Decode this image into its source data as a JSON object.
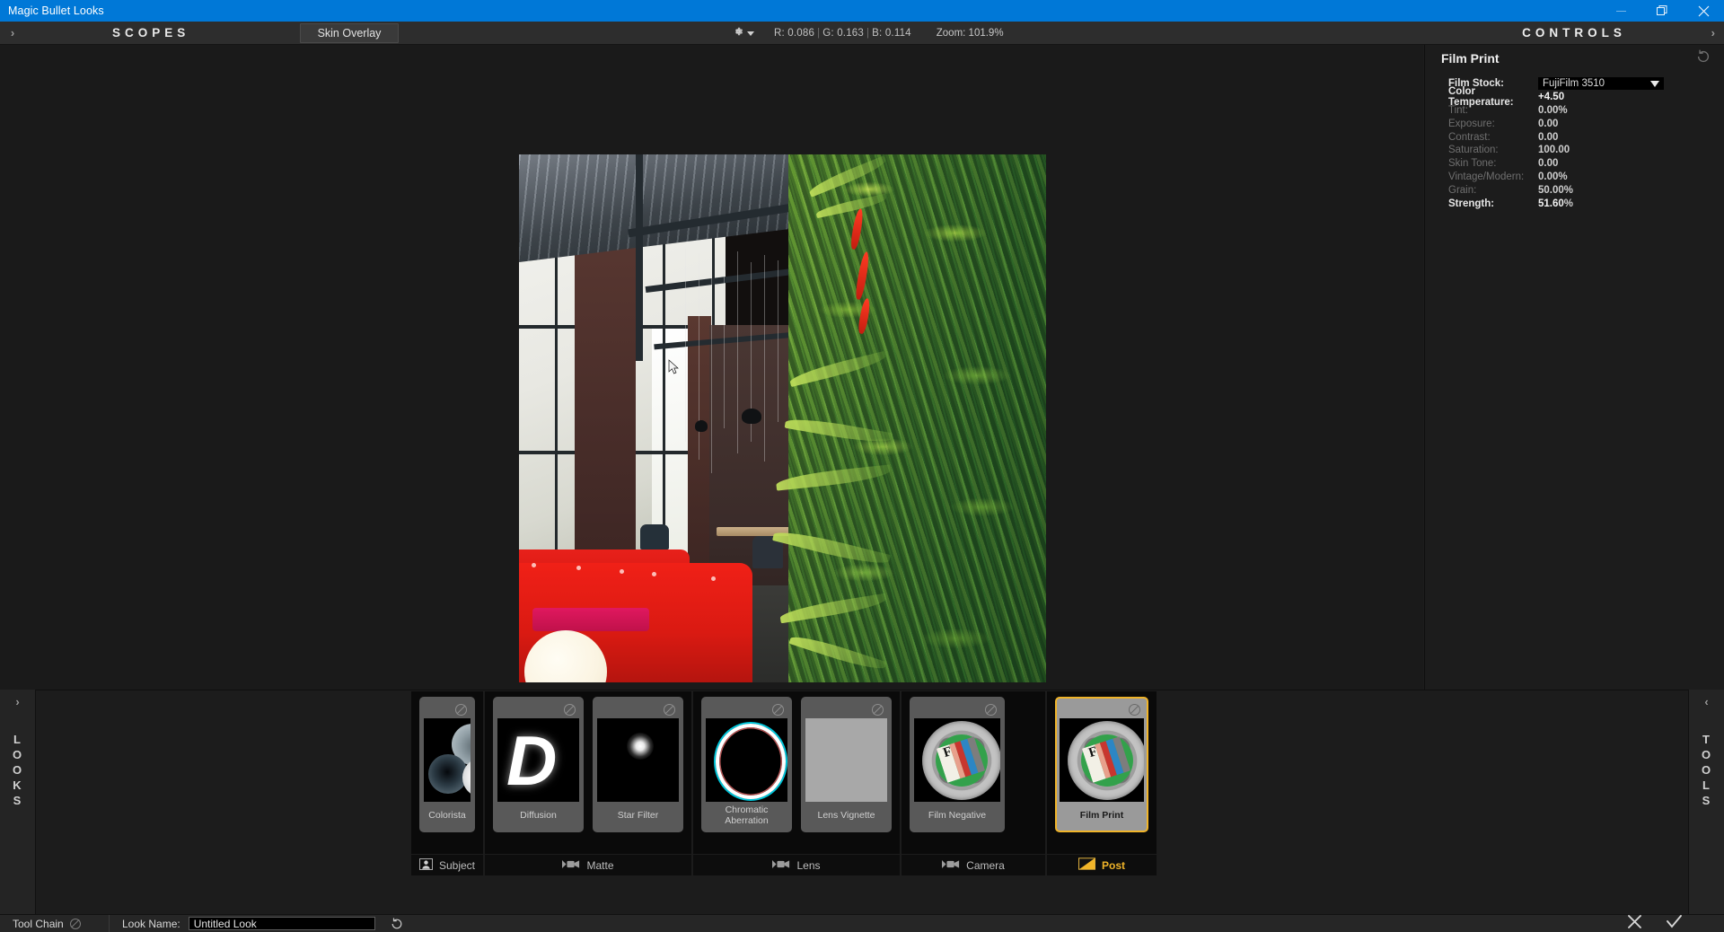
{
  "window": {
    "title": "Magic Bullet Looks",
    "minimize_icon": "minimize-icon",
    "maximize_icon": "restore-icon",
    "close_icon": "close-icon"
  },
  "toolbar": {
    "expand_arrow": "›",
    "scopes_label": "SCOPES",
    "skin_overlay_tab": "Skin Overlay",
    "gear_icon": "gear-icon",
    "rgb_label_r": "R: 0.086",
    "rgb_label_g": "G: 0.163",
    "rgb_label_b": "B: 0.114",
    "separator": "|",
    "zoom_label": "Zoom: 101.9%"
  },
  "controls": {
    "header": "CONTROLS",
    "collapse_arrow": "›",
    "section_title": "Film Print",
    "reset_icon": "reset-icon",
    "rows": [
      {
        "label": "Film Stock:",
        "type": "select",
        "value": "FujiFilm 3510",
        "unit": "",
        "active": true
      },
      {
        "label": "Color Temperature:",
        "type": "value",
        "value": "+4.50",
        "unit": "",
        "active": true
      },
      {
        "label": "Tint:",
        "type": "value",
        "value": "0.00",
        "unit": "%",
        "active": false
      },
      {
        "label": "Exposure:",
        "type": "value",
        "value": "0.00",
        "unit": "",
        "active": false
      },
      {
        "label": "Contrast:",
        "type": "value",
        "value": "0.00",
        "unit": "",
        "active": false
      },
      {
        "label": "Saturation:",
        "type": "value",
        "value": "100.00",
        "unit": "",
        "active": false
      },
      {
        "label": "Skin Tone:",
        "type": "value",
        "value": "0.00",
        "unit": "",
        "active": false
      },
      {
        "label": "Vintage/Modern:",
        "type": "value",
        "value": "0.00",
        "unit": "%",
        "active": false
      },
      {
        "label": "Grain:",
        "type": "value",
        "value": "50.00",
        "unit": "%",
        "active": false
      },
      {
        "label": "Strength:",
        "type": "value",
        "value": "51.60",
        "unit": "%",
        "active": true
      }
    ]
  },
  "rails": {
    "left": {
      "arrow": "›",
      "letters": [
        "L",
        "O",
        "O",
        "K",
        "S"
      ]
    },
    "right": {
      "arrow": "‹",
      "letters": [
        "T",
        "O",
        "O",
        "L",
        "S"
      ]
    }
  },
  "toolchain": {
    "groups": [
      {
        "footer_label": "Subject",
        "footer_icon": "person-icon",
        "tools": [
          {
            "name": "Colorista",
            "thumb": "colorista-thumb",
            "selected": false,
            "disable_icon": "disable-icon"
          }
        ]
      },
      {
        "footer_label": "Matte",
        "footer_icon": "camera-icon",
        "tools": [
          {
            "name": "Diffusion",
            "thumb": "diffusion-thumb",
            "selected": false,
            "disable_icon": "disable-icon"
          },
          {
            "name": "Star Filter",
            "thumb": "star-filter-thumb",
            "selected": false,
            "disable_icon": "disable-icon"
          }
        ]
      },
      {
        "footer_label": "Lens",
        "footer_icon": "camera-icon",
        "tools": [
          {
            "name": "Chromatic Aberration",
            "thumb": "chromatic-aberration-thumb",
            "selected": false,
            "disable_icon": "disable-icon"
          },
          {
            "name": "Lens Vignette",
            "thumb": "lens-vignette-thumb",
            "selected": false,
            "disable_icon": "disable-icon"
          }
        ]
      },
      {
        "footer_label": "Camera",
        "footer_icon": "camera-icon",
        "tools": [
          {
            "name": "Film Negative",
            "thumb": "film-reel-thumb",
            "selected": false,
            "disable_icon": "disable-icon"
          }
        ]
      },
      {
        "footer_label": "Post",
        "footer_icon": "post-icon",
        "tools": [
          {
            "name": "Film Print",
            "thumb": "film-reel-thumb",
            "selected": true,
            "disable_icon": "disable-icon"
          }
        ]
      }
    ]
  },
  "statusbar": {
    "toolchain_label": "Tool Chain",
    "toolchain_disable_icon": "disable-icon",
    "look_name_label": "Look Name:",
    "look_name_value": "Untitled Look",
    "look_name_placeholder": "Untitled Look",
    "reset_icon": "reset-icon",
    "cancel_icon": "close-icon",
    "confirm_icon": "check-icon"
  },
  "colors": {
    "accent_blue": "#0078d7",
    "selected_gold": "#f0b429",
    "panel_bg": "#1c1c1c",
    "toolbar_bg": "#2d2d2d"
  }
}
